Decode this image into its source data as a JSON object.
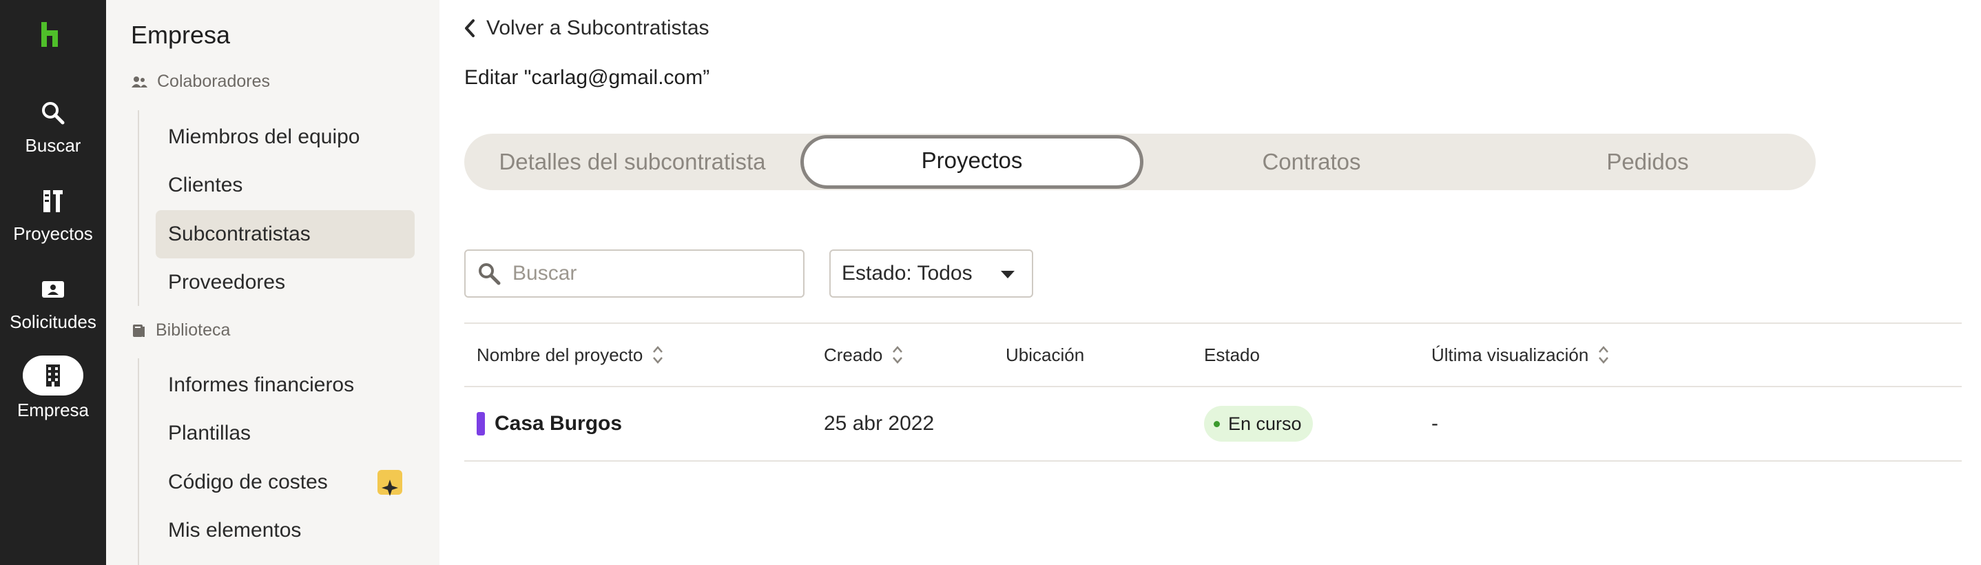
{
  "rail": {
    "items": [
      {
        "label": "Buscar",
        "icon": "search-icon"
      },
      {
        "label": "Proyectos",
        "icon": "projects-icon"
      },
      {
        "label": "Solicitudes",
        "icon": "requests-icon"
      },
      {
        "label": "Empresa",
        "icon": "building-icon",
        "active": true
      }
    ]
  },
  "sidebar": {
    "title": "Empresa",
    "section1": "Colaboradores",
    "section2": "Biblioteca",
    "items": [
      {
        "label": "Miembros del equipo"
      },
      {
        "label": "Clientes"
      },
      {
        "label": "Subcontratistas",
        "active": true
      },
      {
        "label": "Proveedores"
      },
      {
        "label": "Informes financieros"
      },
      {
        "label": "Plantillas"
      },
      {
        "label": "Código de costes",
        "badge_icon": "sparkle-icon"
      },
      {
        "label": "Mis elementos"
      }
    ]
  },
  "main": {
    "back_label": "Volver a Subcontratistas",
    "edit_title": "Editar \"carlag@gmail.com”",
    "tabs": [
      {
        "label": "Detalles del subcontratista"
      },
      {
        "label": "Proyectos",
        "active": true
      },
      {
        "label": "Contratos"
      },
      {
        "label": "Pedidos"
      }
    ],
    "search": {
      "placeholder": "Buscar",
      "value": ""
    },
    "status_filter": "Estado: Todos",
    "table": {
      "headers": [
        "Nombre del proyecto",
        "Creado",
        "Ubicación",
        "Estado",
        "Última visualización"
      ],
      "rows": [
        {
          "name": "Casa Burgos",
          "created": "25 abr 2022",
          "location": "",
          "status": "En curso",
          "last_viewed": "-"
        }
      ]
    }
  },
  "colors": {
    "rail_bg": "#222222",
    "brand_green": "#4fbf2a",
    "project_mark": "#7b3fe4",
    "status_badge_bg": "#e4f6dc",
    "status_dot": "#3c9a2e",
    "sparkle_badge": "#f3c850"
  }
}
